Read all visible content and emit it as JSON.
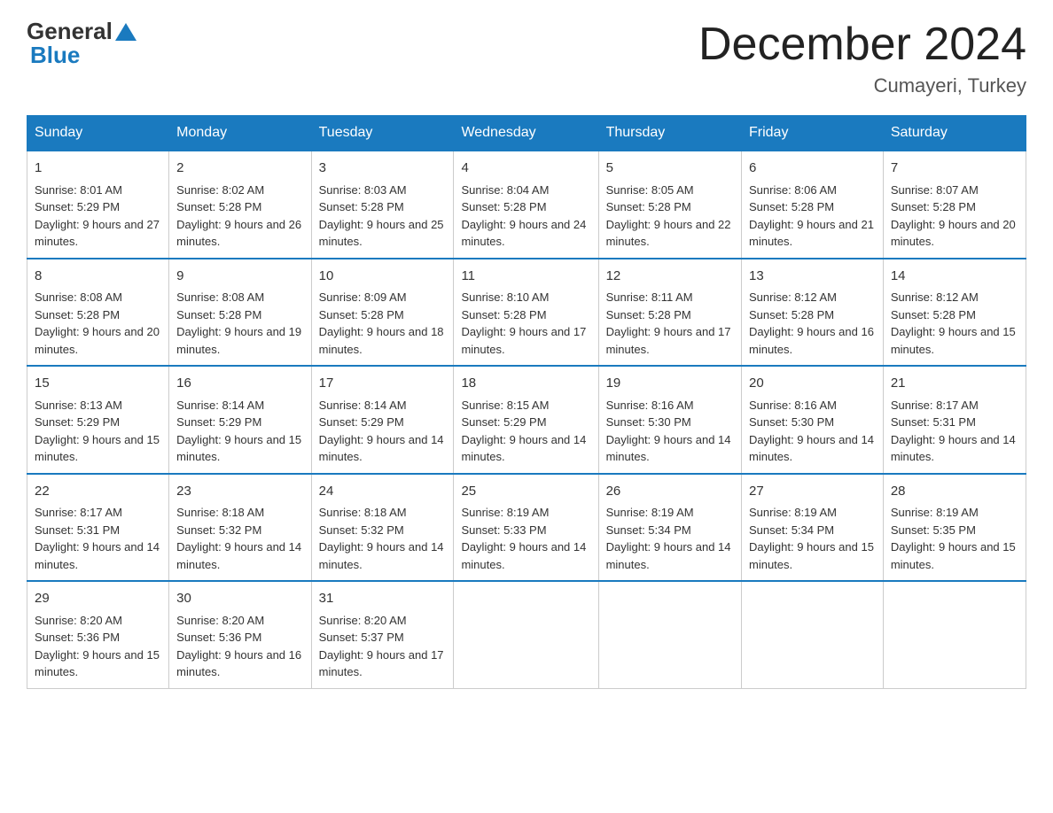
{
  "header": {
    "logo_general": "General",
    "logo_blue": "Blue",
    "month_title": "December 2024",
    "location": "Cumayeri, Turkey"
  },
  "days_of_week": [
    "Sunday",
    "Monday",
    "Tuesday",
    "Wednesday",
    "Thursday",
    "Friday",
    "Saturday"
  ],
  "weeks": [
    [
      {
        "day": "1",
        "sunrise": "8:01 AM",
        "sunset": "5:29 PM",
        "daylight": "9 hours and 27 minutes."
      },
      {
        "day": "2",
        "sunrise": "8:02 AM",
        "sunset": "5:28 PM",
        "daylight": "9 hours and 26 minutes."
      },
      {
        "day": "3",
        "sunrise": "8:03 AM",
        "sunset": "5:28 PM",
        "daylight": "9 hours and 25 minutes."
      },
      {
        "day": "4",
        "sunrise": "8:04 AM",
        "sunset": "5:28 PM",
        "daylight": "9 hours and 24 minutes."
      },
      {
        "day": "5",
        "sunrise": "8:05 AM",
        "sunset": "5:28 PM",
        "daylight": "9 hours and 22 minutes."
      },
      {
        "day": "6",
        "sunrise": "8:06 AM",
        "sunset": "5:28 PM",
        "daylight": "9 hours and 21 minutes."
      },
      {
        "day": "7",
        "sunrise": "8:07 AM",
        "sunset": "5:28 PM",
        "daylight": "9 hours and 20 minutes."
      }
    ],
    [
      {
        "day": "8",
        "sunrise": "8:08 AM",
        "sunset": "5:28 PM",
        "daylight": "9 hours and 20 minutes."
      },
      {
        "day": "9",
        "sunrise": "8:08 AM",
        "sunset": "5:28 PM",
        "daylight": "9 hours and 19 minutes."
      },
      {
        "day": "10",
        "sunrise": "8:09 AM",
        "sunset": "5:28 PM",
        "daylight": "9 hours and 18 minutes."
      },
      {
        "day": "11",
        "sunrise": "8:10 AM",
        "sunset": "5:28 PM",
        "daylight": "9 hours and 17 minutes."
      },
      {
        "day": "12",
        "sunrise": "8:11 AM",
        "sunset": "5:28 PM",
        "daylight": "9 hours and 17 minutes."
      },
      {
        "day": "13",
        "sunrise": "8:12 AM",
        "sunset": "5:28 PM",
        "daylight": "9 hours and 16 minutes."
      },
      {
        "day": "14",
        "sunrise": "8:12 AM",
        "sunset": "5:28 PM",
        "daylight": "9 hours and 15 minutes."
      }
    ],
    [
      {
        "day": "15",
        "sunrise": "8:13 AM",
        "sunset": "5:29 PM",
        "daylight": "9 hours and 15 minutes."
      },
      {
        "day": "16",
        "sunrise": "8:14 AM",
        "sunset": "5:29 PM",
        "daylight": "9 hours and 15 minutes."
      },
      {
        "day": "17",
        "sunrise": "8:14 AM",
        "sunset": "5:29 PM",
        "daylight": "9 hours and 14 minutes."
      },
      {
        "day": "18",
        "sunrise": "8:15 AM",
        "sunset": "5:29 PM",
        "daylight": "9 hours and 14 minutes."
      },
      {
        "day": "19",
        "sunrise": "8:16 AM",
        "sunset": "5:30 PM",
        "daylight": "9 hours and 14 minutes."
      },
      {
        "day": "20",
        "sunrise": "8:16 AM",
        "sunset": "5:30 PM",
        "daylight": "9 hours and 14 minutes."
      },
      {
        "day": "21",
        "sunrise": "8:17 AM",
        "sunset": "5:31 PM",
        "daylight": "9 hours and 14 minutes."
      }
    ],
    [
      {
        "day": "22",
        "sunrise": "8:17 AM",
        "sunset": "5:31 PM",
        "daylight": "9 hours and 14 minutes."
      },
      {
        "day": "23",
        "sunrise": "8:18 AM",
        "sunset": "5:32 PM",
        "daylight": "9 hours and 14 minutes."
      },
      {
        "day": "24",
        "sunrise": "8:18 AM",
        "sunset": "5:32 PM",
        "daylight": "9 hours and 14 minutes."
      },
      {
        "day": "25",
        "sunrise": "8:19 AM",
        "sunset": "5:33 PM",
        "daylight": "9 hours and 14 minutes."
      },
      {
        "day": "26",
        "sunrise": "8:19 AM",
        "sunset": "5:34 PM",
        "daylight": "9 hours and 14 minutes."
      },
      {
        "day": "27",
        "sunrise": "8:19 AM",
        "sunset": "5:34 PM",
        "daylight": "9 hours and 15 minutes."
      },
      {
        "day": "28",
        "sunrise": "8:19 AM",
        "sunset": "5:35 PM",
        "daylight": "9 hours and 15 minutes."
      }
    ],
    [
      {
        "day": "29",
        "sunrise": "8:20 AM",
        "sunset": "5:36 PM",
        "daylight": "9 hours and 15 minutes."
      },
      {
        "day": "30",
        "sunrise": "8:20 AM",
        "sunset": "5:36 PM",
        "daylight": "9 hours and 16 minutes."
      },
      {
        "day": "31",
        "sunrise": "8:20 AM",
        "sunset": "5:37 PM",
        "daylight": "9 hours and 17 minutes."
      },
      null,
      null,
      null,
      null
    ]
  ]
}
